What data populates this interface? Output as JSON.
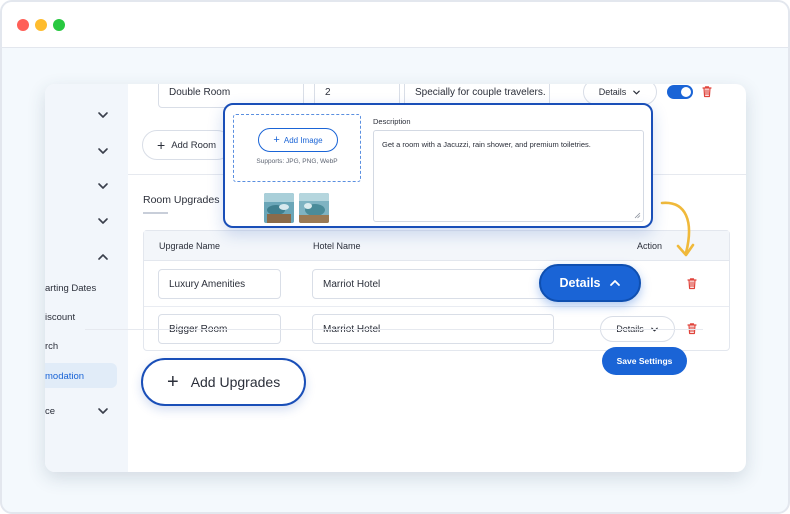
{
  "sidebar": {
    "items": [
      {
        "label": "",
        "chevron": "chevron-down-icon"
      },
      {
        "label": "",
        "chevron": "chevron-down-icon"
      },
      {
        "label": "",
        "chevron": "chevron-down-icon"
      },
      {
        "label": "",
        "chevron": "chevron-down-icon"
      },
      {
        "label": "",
        "chevron": "chevron-up-icon"
      },
      {
        "label": "arting Dates"
      },
      {
        "label": "iscount"
      },
      {
        "label": "rch"
      },
      {
        "label": "modation",
        "active": true
      },
      {
        "label": "ce",
        "chevron": "chevron-down-icon"
      }
    ]
  },
  "rooms": {
    "row": {
      "name": "Double Room",
      "quantity": "2",
      "description": "Specially for couple travelers.",
      "details_label": "Details"
    },
    "add_room_label": "Add Room"
  },
  "upgrades": {
    "section_title": "Room Upgrades",
    "columns": {
      "name": "Upgrade Name",
      "hotel": "Hotel Name",
      "action": "Action"
    },
    "rows": [
      {
        "name": "Luxury Amenities",
        "hotel": "Marriot Hotel",
        "details_label": "Details"
      },
      {
        "name": "Bigger Room",
        "hotel": "Marriot Hotel",
        "details_label": "Details"
      }
    ],
    "add_label": "Add Upgrades"
  },
  "popup": {
    "add_image_label": "Add Image",
    "supports_text": "Supports: JPG, PNG, WebP",
    "description_label": "Description",
    "description_value": "Get a room with a Jacuzzi, rain shower, and premium toiletries."
  },
  "footer": {
    "save_label": "Save Settings"
  },
  "colors": {
    "accent": "#1a64d6",
    "danger": "#e0433b",
    "arrow": "#f0b93a"
  }
}
